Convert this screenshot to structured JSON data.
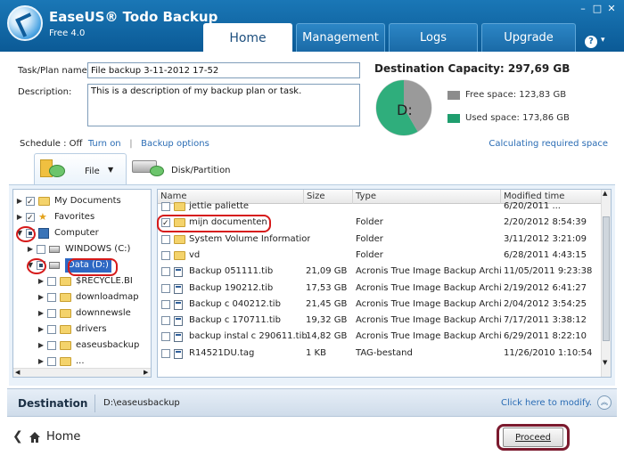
{
  "app": {
    "title": "EaseUS® Todo Backup",
    "version": "Free 4.0",
    "tabs": [
      "Home",
      "Management",
      "Logs",
      "Upgrade"
    ],
    "active_tab": "Home",
    "window_buttons": [
      "–",
      "□",
      "✕"
    ],
    "help": "?",
    "help_arrow": "▾"
  },
  "task": {
    "name_label": "Task/Plan name:",
    "name_value": "File backup 3-11-2012 17-52",
    "desc_label": "Description:",
    "desc_value": "This is a description of my backup plan or task."
  },
  "destination_capacity": {
    "title": "Destination Capacity: 297,69 GB",
    "drive_label": "D:",
    "free_label": "Free space: 123,83 GB",
    "used_label": "Used space: 173,86 GB",
    "free_gb": 123.83,
    "used_gb": 173.86,
    "free_color": "#8c8c8c",
    "used_color": "#1f9e6e"
  },
  "schedule": {
    "text": "Schedule : Off",
    "turn_on": "Turn on",
    "separator": "|",
    "backup_options": "Backup options",
    "calc": "Calculating required space"
  },
  "subtabs": {
    "file": "File",
    "file_arrow": "▼",
    "disk": "Disk/Partition"
  },
  "tree": [
    {
      "label": "My Documents",
      "level": 0,
      "expander": "▶",
      "check": "checked",
      "icon": "folder"
    },
    {
      "label": "Favorites",
      "level": 0,
      "expander": "▶",
      "check": "checked",
      "icon": "star"
    },
    {
      "label": "Computer",
      "level": 0,
      "expander": "▼",
      "check": "partial",
      "icon": "computer"
    },
    {
      "label": "WINDOWS (C:)",
      "level": 1,
      "expander": "▶",
      "check": "none",
      "icon": "drive"
    },
    {
      "label": "Data (D:)",
      "level": 1,
      "expander": "▼",
      "check": "partial",
      "icon": "drive",
      "selected": true
    },
    {
      "label": "$RECYCLE.BI",
      "level": 2,
      "expander": "▶",
      "check": "none",
      "icon": "folder"
    },
    {
      "label": "downloadmap",
      "level": 2,
      "expander": "▶",
      "check": "none",
      "icon": "folder"
    },
    {
      "label": "downnewsle",
      "level": 2,
      "expander": "▶",
      "check": "none",
      "icon": "folder"
    },
    {
      "label": "drivers",
      "level": 2,
      "expander": "▶",
      "check": "none",
      "icon": "folder"
    },
    {
      "label": "easeusbackup",
      "level": 2,
      "expander": "▶",
      "check": "none",
      "icon": "folder"
    },
    {
      "label": "...",
      "level": 2,
      "expander": "▶",
      "check": "none",
      "icon": "folder"
    }
  ],
  "tree_hscroll": [
    "◀",
    "▶"
  ],
  "list": {
    "columns": [
      "Name",
      "Size",
      "Type",
      "Modified time"
    ],
    "rows": [
      {
        "name": "jettie paliette",
        "size": "",
        "type": "",
        "modified": "6/20/2011 ...",
        "icon": "folder",
        "checked": false
      },
      {
        "name": "mijn documenten",
        "size": "",
        "type": "Folder",
        "modified": "2/20/2012 8:54:39",
        "icon": "folder",
        "checked": true
      },
      {
        "name": "System Volume Information",
        "size": "",
        "type": "Folder",
        "modified": "3/11/2012 3:21:09",
        "icon": "folder",
        "checked": false
      },
      {
        "name": "vd",
        "size": "",
        "type": "Folder",
        "modified": "6/28/2011 4:43:15",
        "icon": "folder",
        "checked": false
      },
      {
        "name": "Backup 051111.tib",
        "size": "21,09 GB",
        "type": "Acronis True Image Backup Archive",
        "modified": "11/05/2011 9:23:38",
        "icon": "tib",
        "checked": false
      },
      {
        "name": "Backup 190212.tib",
        "size": "17,53 GB",
        "type": "Acronis True Image Backup Archive",
        "modified": "2/19/2012 6:41:27",
        "icon": "tib",
        "checked": false
      },
      {
        "name": "Backup c 040212.tib",
        "size": "21,45 GB",
        "type": "Acronis True Image Backup Archive",
        "modified": "2/04/2012 3:54:25",
        "icon": "tib",
        "checked": false
      },
      {
        "name": "Backup c 170711.tib",
        "size": "19,32 GB",
        "type": "Acronis True Image Backup Archive",
        "modified": "7/17/2011 3:38:12",
        "icon": "tib",
        "checked": false
      },
      {
        "name": "backup instal c 290611.tib",
        "size": "14,82 GB",
        "type": "Acronis True Image Backup Archive",
        "modified": "6/29/2011 8:22:10",
        "icon": "tib",
        "checked": false
      },
      {
        "name": "R14521DU.tag",
        "size": "1 KB",
        "type": "TAG-bestand",
        "modified": "11/26/2010 1:10:54",
        "icon": "tib",
        "checked": false
      }
    ],
    "scroll_arrows": [
      "▲",
      "▼",
      "▶"
    ]
  },
  "destination": {
    "title": "Destination",
    "path": "D:\\easeusbackup",
    "modify": "Click here to modify.",
    "up": "︽"
  },
  "footer": {
    "back": "❮",
    "home": "Home",
    "proceed": "Proceed"
  }
}
